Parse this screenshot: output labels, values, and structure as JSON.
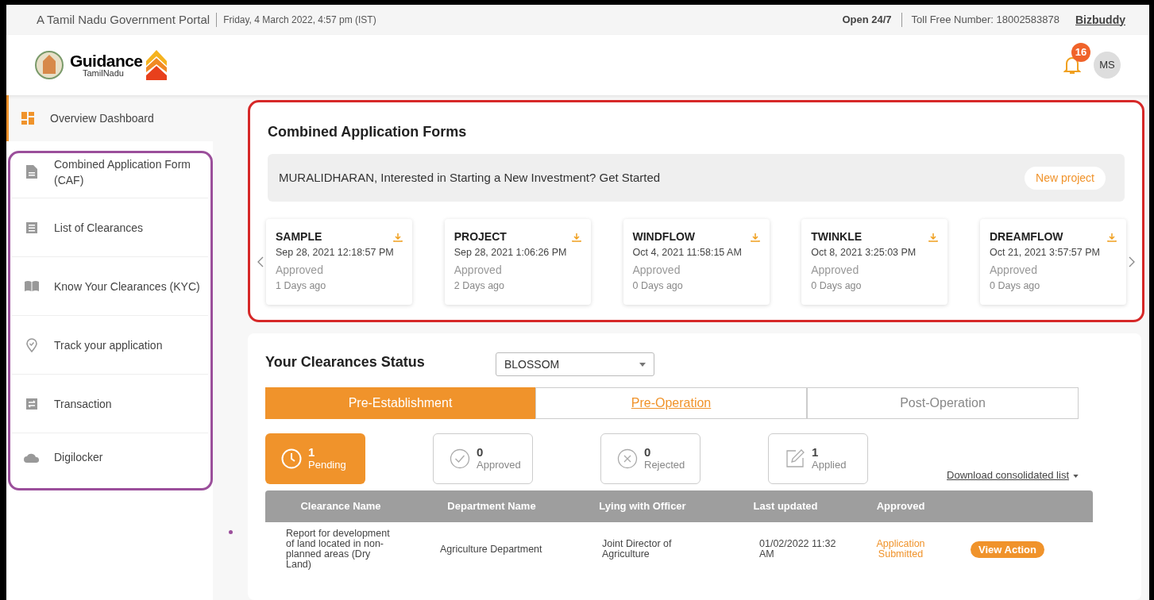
{
  "top_bar": {
    "portal": "A Tamil Nadu Government Portal",
    "datetime": "Friday, 4 March 2022, 4:57 pm (IST)",
    "open": "Open 24/7",
    "toll_free": "Toll Free Number: 18002583878",
    "link": "Bizbuddy"
  },
  "header": {
    "logo_title": "Guidance",
    "logo_subtitle": "TamilNadu",
    "notifications": "16",
    "avatar": "MS"
  },
  "sidebar": {
    "items": [
      {
        "label": "Overview Dashboard",
        "selected": true
      },
      {
        "label": "Combined Application Form (CAF)",
        "selected": false
      },
      {
        "label": "List of Clearances",
        "selected": false
      },
      {
        "label": "Know Your Clearances (KYC)",
        "selected": false
      },
      {
        "label": "Track your application",
        "selected": false
      },
      {
        "label": "Transaction",
        "selected": false
      },
      {
        "label": "Digilocker",
        "selected": false
      }
    ]
  },
  "caf": {
    "title": "Combined Application Forms",
    "banner": "MURALIDHARAN, Interested in Starting a New Investment? Get Started",
    "button": "New project",
    "cards": [
      {
        "name": "SAMPLE",
        "date": "Sep 28, 2021 12:18:57 PM",
        "status": "Approved",
        "age": "1 Days ago"
      },
      {
        "name": "PROJECT",
        "date": "Sep 28, 2021 1:06:26 PM",
        "status": "Approved",
        "age": "2 Days ago"
      },
      {
        "name": "WINDFLOW",
        "date": "Oct 4, 2021 11:58:15 AM",
        "status": "Approved",
        "age": "0 Days ago"
      },
      {
        "name": "TWINKLE",
        "date": "Oct 8, 2021 3:25:03 PM",
        "status": "Approved",
        "age": "0 Days ago"
      },
      {
        "name": "DREAMFLOW",
        "date": "Oct 21, 2021 3:57:57 PM",
        "status": "Approved",
        "age": "0 Days ago"
      }
    ]
  },
  "clearances": {
    "title": "Your Clearances Status",
    "dropdown": "BLOSSOM",
    "tabs": [
      {
        "label": "Pre-Establishment",
        "selected": true,
        "kind": "plain"
      },
      {
        "label": "Pre-Operation",
        "selected": false,
        "kind": "link"
      },
      {
        "label": "Post-Operation",
        "selected": false,
        "kind": "plain"
      }
    ],
    "stats": [
      {
        "count": "1",
        "label": "Pending",
        "selected": true,
        "kind": "clock"
      },
      {
        "count": "0",
        "label": "Approved",
        "selected": false,
        "kind": "check"
      },
      {
        "count": "0",
        "label": "Rejected",
        "selected": false,
        "kind": "cross"
      },
      {
        "count": "1",
        "label": "Applied",
        "selected": false,
        "kind": "edit"
      }
    ],
    "download": "Download consolidated list",
    "columns": [
      "Clearance Name",
      "Department Name",
      "Lying with Officer",
      "Last updated",
      "Approved"
    ],
    "rows": [
      {
        "cells": [
          "Report for development of land located in non-planned areas (Dry Land)",
          "Agriculture Department",
          "Joint Director of Agriculture",
          "01/02/2022 11:32 AM"
        ],
        "status": "Application Submitted",
        "action": "View Action"
      }
    ]
  }
}
